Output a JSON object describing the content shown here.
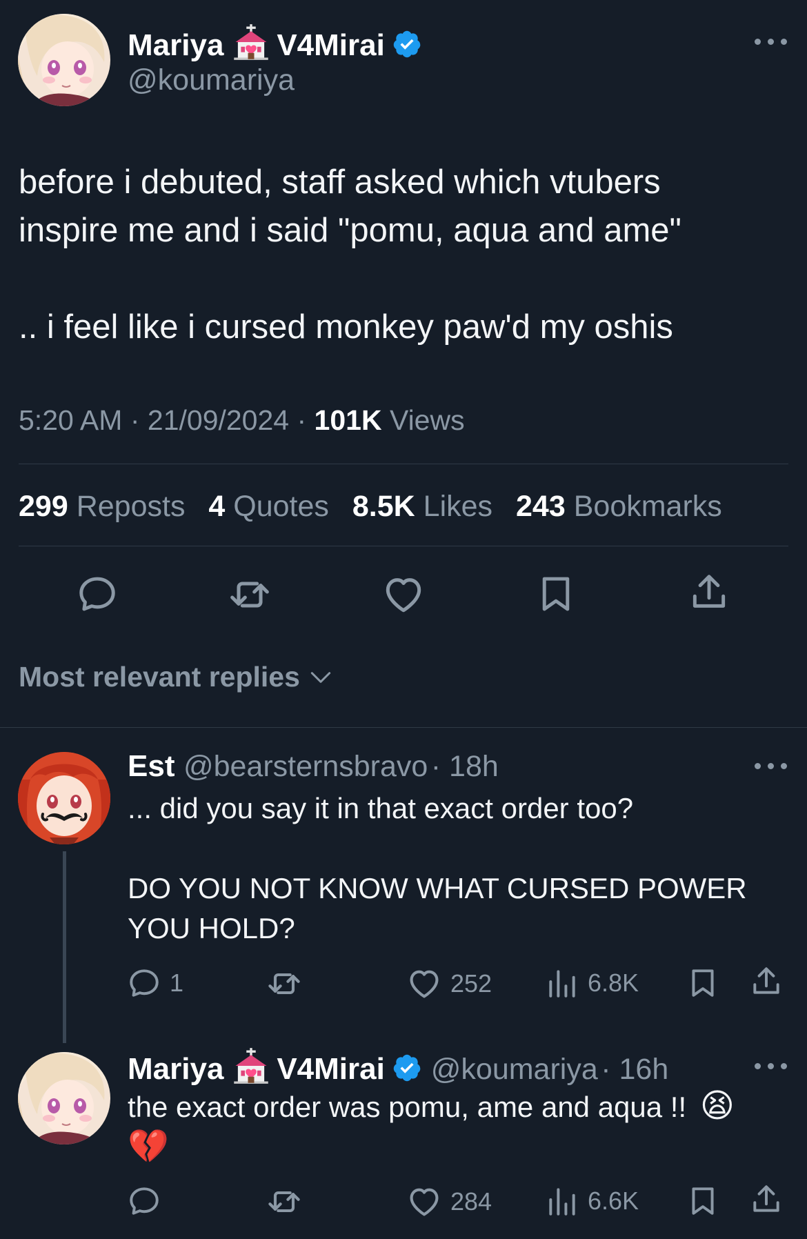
{
  "tweet": {
    "author_name_part1": "Mariya",
    "author_name_part2": "V4Mirai",
    "author_handle": "@koumariya",
    "author_emoji": "💒",
    "text_line1": "before i debuted, staff asked which vtubers",
    "text_line2": "inspire me and i said \"pomu, aqua and ame\"",
    "text_line3": ".. i feel like i cursed monkey paw'd my oshis",
    "time": "5:20 AM",
    "date": "21/09/2024",
    "views_count": "101K",
    "views_label": "Views",
    "reposts_count": "299",
    "reposts_label": "Reposts",
    "quotes_count": "4",
    "quotes_label": "Quotes",
    "likes_count": "8.5K",
    "likes_label": "Likes",
    "bookmarks_count": "243",
    "bookmarks_label": "Bookmarks"
  },
  "sort_label": "Most relevant replies",
  "replies": [
    {
      "name": "Est",
      "handle": "@bearsternsbravo",
      "age": "18h",
      "line1": "... did you say it in that exact order too?",
      "line2": "DO YOU NOT KNOW WHAT CURSED POWER",
      "line3": "YOU HOLD?",
      "replies": "1",
      "likes": "252",
      "views": "6.8K"
    },
    {
      "name_part1": "Mariya",
      "name_part2": "V4Mirai",
      "handle": "@koumariya",
      "age": "16h",
      "line1": "the exact order was pomu, ame and aqua !!",
      "emoji1": "😫",
      "emoji2": "💔",
      "likes": "284",
      "views": "6.6K"
    }
  ],
  "icons": {
    "verified": "verified-badge-icon",
    "chapel": "wedding-chapel-icon",
    "more": "more-dots-icon",
    "reply": "reply-icon",
    "repost": "repost-icon",
    "like": "heart-icon",
    "bookmark": "bookmark-icon",
    "share": "share-icon",
    "views": "views-chart-icon",
    "chevron": "chevron-down-icon"
  },
  "colors": {
    "background": "#151d28",
    "muted": "#8b98a5",
    "verified": "#1d9bf0",
    "divider": "#2f3a46"
  }
}
